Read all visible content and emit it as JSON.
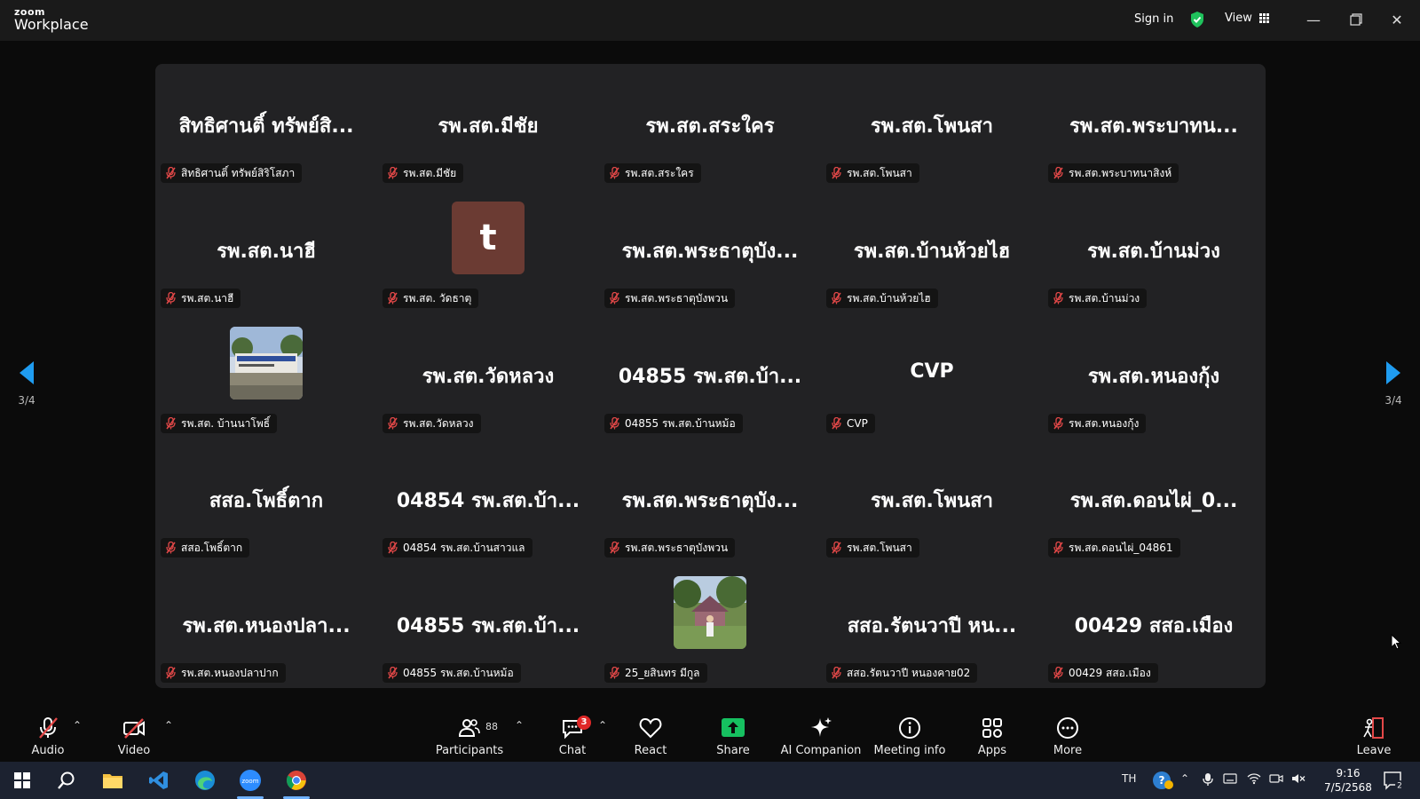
{
  "titlebar": {
    "brand_small": "zoom",
    "brand_big": "Workplace",
    "sign_in": "Sign in",
    "view": "View"
  },
  "gallery": {
    "page_indicator_left": "3/4",
    "page_indicator_right": "3/4",
    "tiles": [
      {
        "display": "สิทธิศานติ์ ทรัพย์สิ...",
        "label": "สิทธิศานติ์ ทรัพย์สิริโสภา",
        "kind": "name"
      },
      {
        "display": "รพ.สต.มีชัย",
        "label": "รพ.สต.มีชัย",
        "kind": "name"
      },
      {
        "display": "รพ.สต.สระใคร",
        "label": "รพ.สต.สระใคร",
        "kind": "name"
      },
      {
        "display": "รพ.สต.โพนสา",
        "label": "รพ.สต.โพนสา",
        "kind": "name"
      },
      {
        "display": "รพ.สต.พระบาทน...",
        "label": "รพ.สต.พระบาทนาสิงห์",
        "kind": "name"
      },
      {
        "display": "รพ.สต.นาฮี",
        "label": "รพ.สต.นาฮี",
        "kind": "name"
      },
      {
        "display": "t",
        "label": "รพ.สต. วัดธาตุ",
        "kind": "letter"
      },
      {
        "display": "รพ.สต.พระธาตุบัง...",
        "label": "รพ.สต.พระธาตุบังพวน",
        "kind": "name"
      },
      {
        "display": "รพ.สต.บ้านห้วยไฮ",
        "label": "รพ.สต.บ้านห้วยไฮ",
        "kind": "name"
      },
      {
        "display": "รพ.สต.บ้านม่วง",
        "label": "รพ.สต.บ้านม่วง",
        "kind": "name"
      },
      {
        "display": "",
        "label": "รพ.สต. บ้านนาโพธิ์",
        "kind": "photo-building"
      },
      {
        "display": "รพ.สต.วัดหลวง",
        "label": "รพ.สต.วัดหลวง",
        "kind": "name"
      },
      {
        "display": "04855 รพ.สต.บ้า...",
        "label": "04855 รพ.สต.บ้านหม้อ",
        "kind": "name"
      },
      {
        "display": "CVP",
        "label": "CVP",
        "kind": "name"
      },
      {
        "display": "รพ.สต.หนองกุ้ง",
        "label": "รพ.สต.หนองกุ้ง",
        "kind": "name"
      },
      {
        "display": "สสอ.โพธิ์ตาก",
        "label": "สสอ.โพธิ์ตาก",
        "kind": "name"
      },
      {
        "display": "04854 รพ.สต.บ้า...",
        "label": "04854 รพ.สต.บ้านสาวแล",
        "kind": "name"
      },
      {
        "display": "รพ.สต.พระธาตุบัง...",
        "label": "รพ.สต.พระธาตุบังพวน",
        "kind": "name"
      },
      {
        "display": "รพ.สต.โพนสา",
        "label": "รพ.สต.โพนสา",
        "kind": "name"
      },
      {
        "display": "รพ.สต.ดอนไผ่_0...",
        "label": "รพ.สต.ดอนไผ่_04861",
        "kind": "name"
      },
      {
        "display": "รพ.สต.หนองปลา...",
        "label": "รพ.สต.หนองปลาปาก",
        "kind": "name"
      },
      {
        "display": "04855 รพ.สต.บ้า...",
        "label": "04855 รพ.สต.บ้านหม้อ",
        "kind": "name"
      },
      {
        "display": "",
        "label": "25_ยสินทร มีกูล",
        "kind": "photo-person"
      },
      {
        "display": "สสอ.รัตนวาปี หน...",
        "label": "สสอ.รัตนวาปี หนองคาย02",
        "kind": "name"
      },
      {
        "display": "00429 สสอ.เมือง",
        "label": "00429 สสอ.เมือง",
        "kind": "name"
      }
    ]
  },
  "toolbar": {
    "audio": "Audio",
    "video": "Video",
    "participants": "Participants",
    "participants_count": "88",
    "chat": "Chat",
    "chat_badge": "3",
    "react": "React",
    "share": "Share",
    "ai_companion": "AI Companion",
    "meeting_info": "Meeting info",
    "apps": "Apps",
    "more": "More",
    "leave": "Leave"
  },
  "taskbar": {
    "language": "TH",
    "time": "9:16",
    "date": "7/5/2568",
    "notifications": "2"
  },
  "colors": {
    "accent_blue": "#1f9cf0",
    "share_green": "#16c060",
    "mute_red": "#e34848",
    "shield_green": "#1fc25c"
  }
}
